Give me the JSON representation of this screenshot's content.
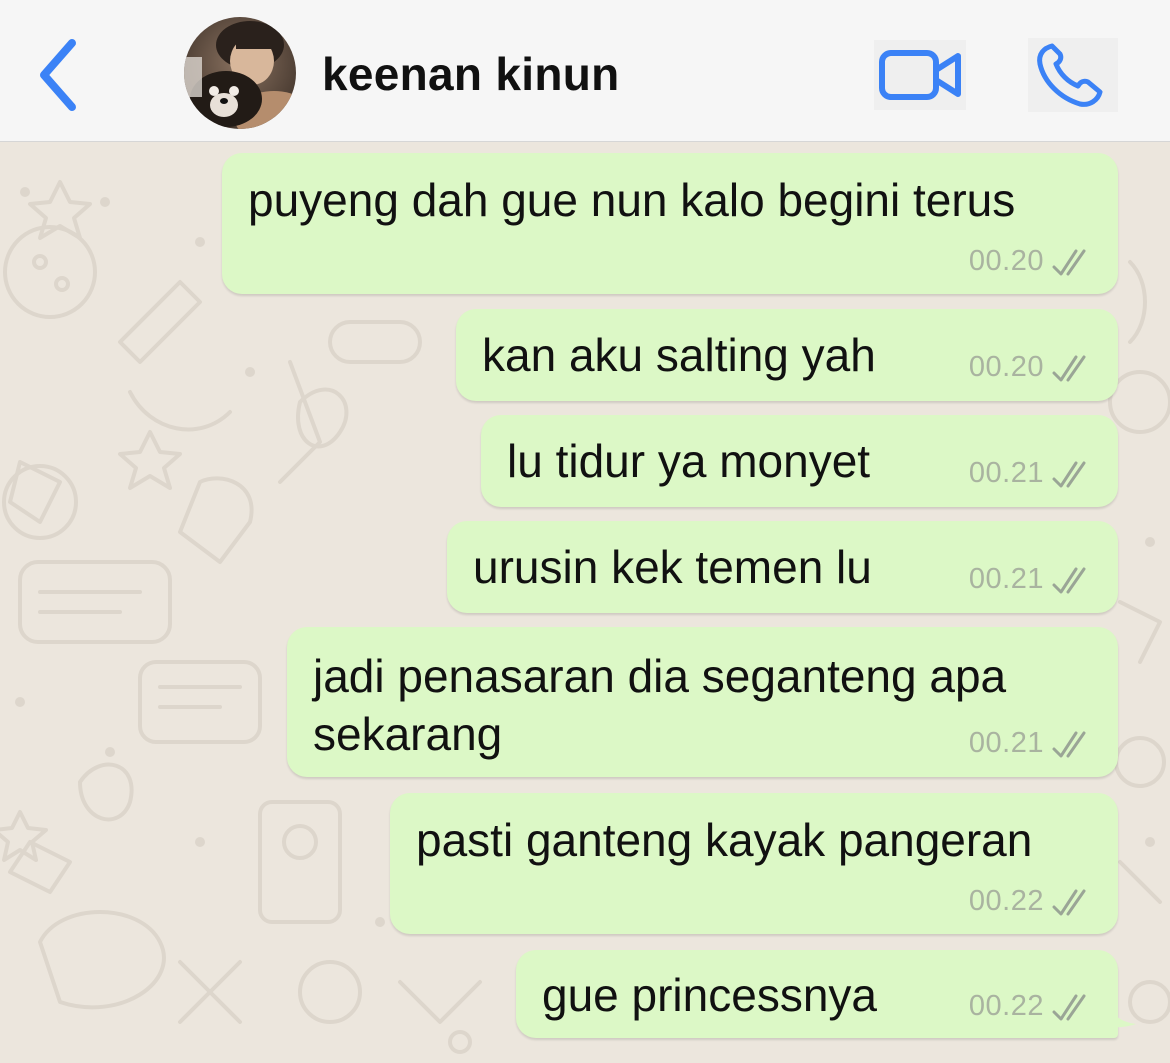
{
  "header": {
    "back_icon": "chevron-left-icon",
    "contact_name": "keenan kinun",
    "video_icon": "video-camera-icon",
    "call_icon": "phone-icon"
  },
  "colors": {
    "accent": "#3b82f6",
    "bubble_out": "#dcf8c6",
    "wallpaper": "#ece6dd",
    "header_bg": "#f6f6f6",
    "timestamp": "#a9b3a0"
  },
  "messages": [
    {
      "text": "puyeng dah gue nun kalo begini terus",
      "time": "00.20",
      "status": "read-ticks-icon"
    },
    {
      "text": "kan aku salting yah",
      "time": "00.20",
      "status": "read-ticks-icon"
    },
    {
      "text": "lu tidur ya monyet",
      "time": "00.21",
      "status": "read-ticks-icon"
    },
    {
      "text": "urusin kek temen lu",
      "time": "00.21",
      "status": "read-ticks-icon"
    },
    {
      "text": "jadi penasaran dia seganteng apa",
      "text_line2": "sekarang",
      "time": "00.21",
      "status": "read-ticks-icon"
    },
    {
      "text": "pasti ganteng kayak pangeran",
      "time": "00.22",
      "status": "read-ticks-icon"
    },
    {
      "text": "gue princessnya",
      "time": "00.22",
      "status": "read-ticks-icon"
    }
  ]
}
